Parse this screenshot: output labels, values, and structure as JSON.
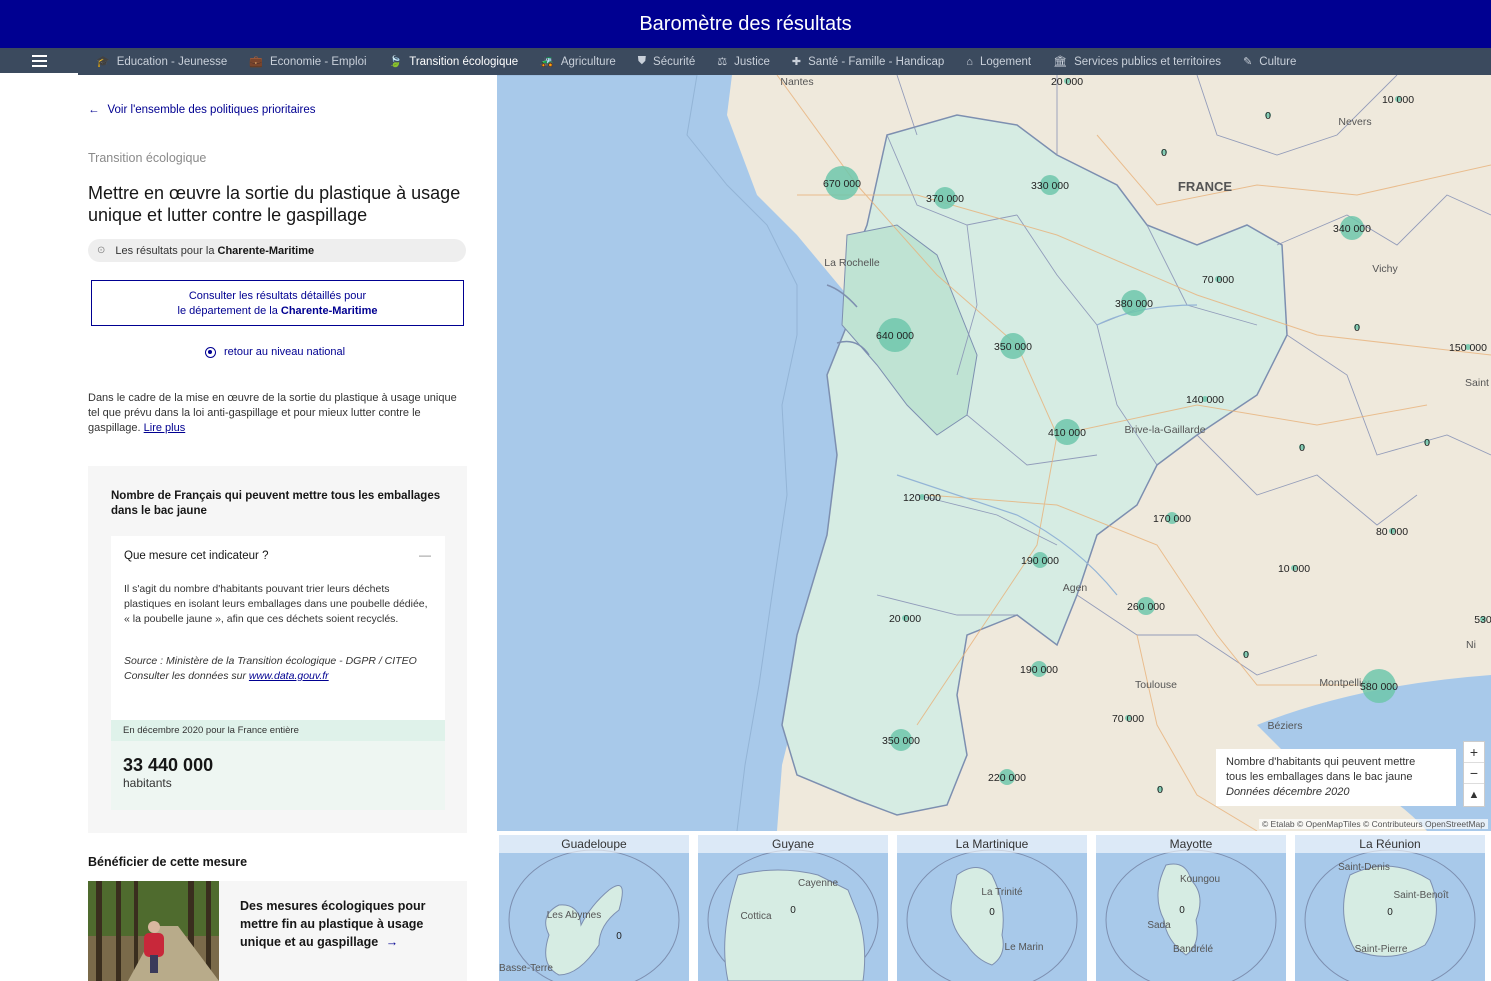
{
  "header": {
    "title": "Baromètre des résultats"
  },
  "nav": {
    "items": [
      {
        "label": "Education - Jeunesse",
        "icon": "graduation-cap-icon",
        "glyph": "🎓"
      },
      {
        "label": "Economie - Emploi",
        "icon": "briefcase-icon",
        "glyph": "💼"
      },
      {
        "label": "Transition écologique",
        "icon": "leaf-icon",
        "glyph": "🍃"
      },
      {
        "label": "Agriculture",
        "icon": "tractor-icon",
        "glyph": "🚜"
      },
      {
        "label": "Sécurité",
        "icon": "shield-icon",
        "glyph": "⛊"
      },
      {
        "label": "Justice",
        "icon": "scales-icon",
        "glyph": "⚖"
      },
      {
        "label": "Santé - Famille - Handicap",
        "icon": "medical-kit-icon",
        "glyph": "✚"
      },
      {
        "label": "Logement",
        "icon": "home-icon",
        "glyph": "⌂"
      },
      {
        "label": "Services publics et territoires",
        "icon": "building-icon",
        "glyph": "🏛"
      },
      {
        "label": "Culture",
        "icon": "brush-icon",
        "glyph": "✎"
      }
    ],
    "active_index": 2
  },
  "sidebar": {
    "back_link": "Voir l'ensemble des politiques prioritaires",
    "category": "Transition écologique",
    "title": "Mettre en œuvre la sortie du plastique à usage unique et lutter contre le gaspillage",
    "location_prefix": "Les résultats pour la",
    "location_name": "Charente-Maritime",
    "detail_button_line1": "Consulter les résultats détaillés pour",
    "detail_button_line2_prefix": "le département de la",
    "detail_button_line2_name": "Charente-Maritime",
    "national_link": "retour au niveau national",
    "description": "Dans le cadre de la mise en œuvre de la sortie du plastique à usage unique tel que prévu dans la loi anti-gaspillage et pour mieux lutter contre le gaspillage.",
    "read_more": "Lire plus"
  },
  "indicator": {
    "title": "Nombre de Français qui peuvent mettre tous les emballages dans le bac jaune",
    "question": "Que mesure cet indicateur ?",
    "collapse_symbol": "—",
    "explanation": "Il s'agit du nombre d'habitants pouvant trier leurs déchets plastiques en isolant leurs emballages dans une poubelle dédiée, « la poubelle jaune », afin que ces déchets soient recyclés.",
    "source": "Source : Ministère de la Transition écologique - DGPR / CITEO",
    "data_link_prefix": "Consulter les données sur",
    "data_link": "www.data.gouv.fr",
    "period": "En décembre 2020 pour la France entière",
    "value": "33 440 000",
    "unit": "habitants"
  },
  "benefit": {
    "heading": "Bénéficier de cette mesure",
    "card_text": "Des mesures écologiques pour mettre fin au plastique à usage unique et au gaspillage",
    "card_arrow": "→"
  },
  "map": {
    "legend_line1": "Nombre d'habitants qui peuvent mettre",
    "legend_line2": "tous les emballages dans le bac jaune",
    "legend_line3": "Données décembre 2020",
    "zoom_in": "+",
    "zoom_out": "−",
    "reset": "▲",
    "attribution": "© Etalab © OpenMapTiles © Contributeurs OpenStreetMap",
    "place_labels": [
      "Nantes",
      "Nevers",
      "FRANCE",
      "La Rochelle",
      "Vichy",
      "Saint",
      "Brive-la-Gaillarde",
      "Agen",
      "Toulouse",
      "Montpellier",
      "Béziers",
      "Ni"
    ],
    "bubbles": [
      "20 000",
      "10 000",
      "0",
      "0",
      "670 000",
      "370 000",
      "330 000",
      "340 000",
      "70 000",
      "380 000",
      "640 000",
      "350 000",
      "0",
      "150 000",
      "140 000",
      "410 000",
      "0",
      "0",
      "120 000",
      "170 000",
      "80 000",
      "190 000",
      "10 000",
      "530",
      "20 000",
      "260 000",
      "0",
      "190 000",
      "580 000",
      "70 000",
      "350 000",
      "220 000",
      "0"
    ],
    "accent_color": "#6fc7ac",
    "region_color": "#d6ece3",
    "sea_color": "#a8c9ea"
  },
  "insets": [
    {
      "name": "Guadeloupe",
      "labels": [
        "Les Abymes",
        "Basse-Terre"
      ],
      "value": "0"
    },
    {
      "name": "Guyane",
      "labels": [
        "Cayenne",
        "Cottica"
      ],
      "value": "0"
    },
    {
      "name": "La Martinique",
      "labels": [
        "La Trinité",
        "Le Marin"
      ],
      "value": "0"
    },
    {
      "name": "Mayotte",
      "labels": [
        "Koungou",
        "Sada",
        "Bandrélé"
      ],
      "value": "0"
    },
    {
      "name": "La Réunion",
      "labels": [
        "Saint-Denis",
        "Saint-Benoît",
        "Saint-Pierre"
      ],
      "value": "0"
    }
  ]
}
